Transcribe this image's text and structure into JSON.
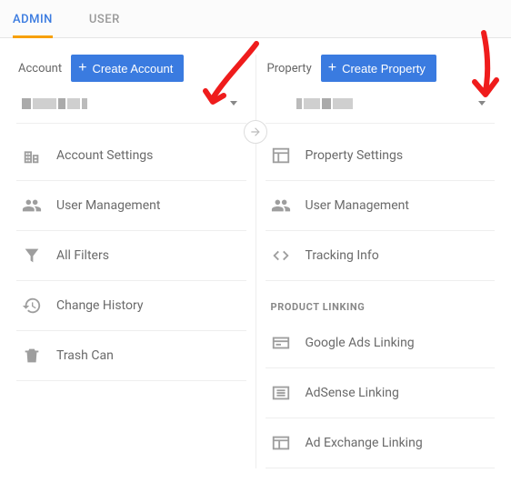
{
  "tabs": {
    "admin": "ADMIN",
    "user": "USER"
  },
  "account": {
    "label": "Account",
    "create_label": "Create Account",
    "menu": {
      "settings": "Account Settings",
      "user_mgmt": "User Management",
      "filters": "All Filters",
      "history": "Change History",
      "trash": "Trash Can"
    }
  },
  "property": {
    "label": "Property",
    "create_label": "Create Property",
    "menu": {
      "settings": "Property Settings",
      "user_mgmt": "User Management",
      "tracking": "Tracking Info"
    },
    "product_linking_title": "PRODUCT LINKING",
    "product_linking": {
      "ads": "Google Ads Linking",
      "adsense": "AdSense Linking",
      "adexchange": "Ad Exchange Linking"
    }
  }
}
